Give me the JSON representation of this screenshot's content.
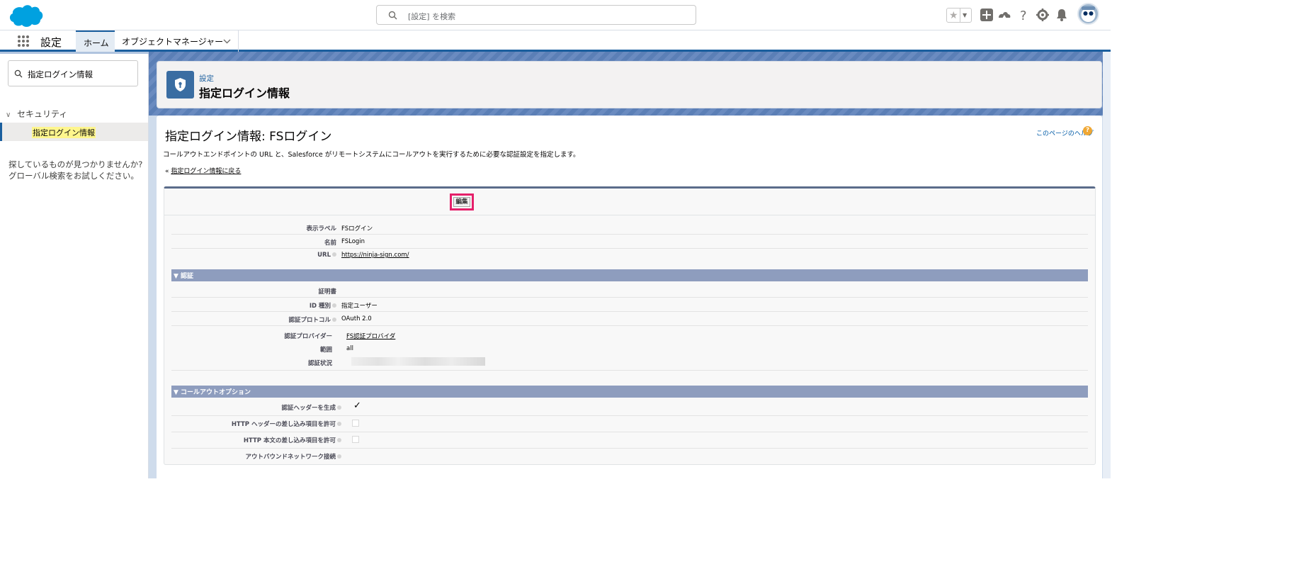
{
  "header": {
    "search_placeholder": "[設定] を検索",
    "brand_color": "#00a1e0"
  },
  "navbar": {
    "app_name": "設定",
    "tab_home": "ホーム",
    "tab_object_manager": "オブジェクトマネージャー"
  },
  "sidebar": {
    "quickfind_value": "指定ログイン情報",
    "section_label": "セキュリティ",
    "item_label": "指定ログイン情報",
    "no_results_text": "探しているものが見つかりませんか? グローバル検索をお試しください。"
  },
  "page_header": {
    "eyebrow": "設定",
    "title": "指定ログイン情報"
  },
  "detail": {
    "title": "指定ログイン情報: FSログイン",
    "help_link": "このページのヘルプ",
    "help_icon": "?",
    "description": "コールアウトエンドポイントの URL と、Salesforce がリモートシステムにコールアウトを実行するために必要な認証設定を指定します。",
    "back_prefix": "«",
    "back_link": "指定ログイン情報に戻る",
    "edit_button": "編集",
    "fields": {
      "label_label": "表示ラベル",
      "label_value": "FSログイン",
      "name_label": "名前",
      "name_value": "FSLogin",
      "url_label": "URL",
      "url_value": "https://ninja-sign.com/"
    },
    "auth_section": {
      "title": "▼ 認証",
      "cert_label": "証明書",
      "idtype_label": "ID 種別",
      "idtype_value": "指定ユーザー",
      "protocol_label": "認証プロトコル",
      "protocol_value": "OAuth 2.0",
      "provider_label": "認証プロバイダー",
      "provider_value": "FS認証プロバイダ",
      "scope_label": "範囲",
      "scope_value": "all",
      "status_label": "認証状況"
    },
    "callout_section": {
      "title": "▼ コールアウトオプション",
      "gen_header_label": "認証ヘッダーを生成",
      "gen_header_checked": true,
      "merge_header_label": "HTTP ヘッダーの差し込み項目を許可",
      "merge_header_checked": false,
      "merge_body_label": "HTTP 本文の差し込み項目を許可",
      "merge_body_checked": false,
      "outbound_label": "アウトバウンドネットワーク接続"
    }
  }
}
